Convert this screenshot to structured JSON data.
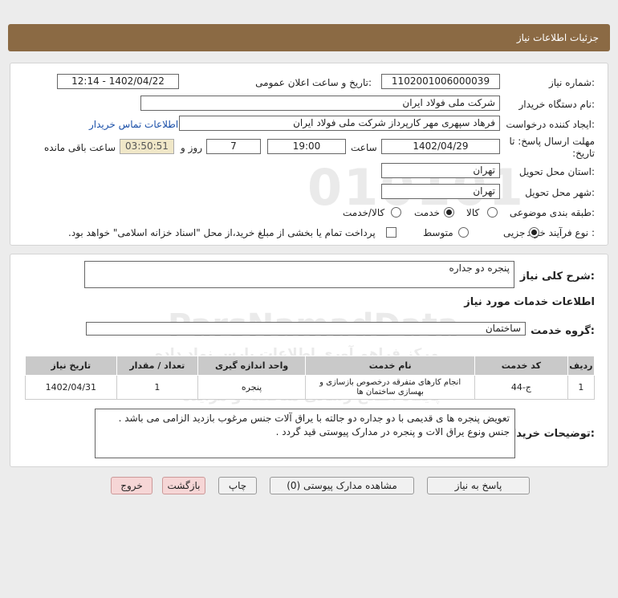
{
  "header": {
    "title": "جزئیات اطلاعات نیاز"
  },
  "form": {
    "need_number_label": "شماره نیاز:",
    "need_number": "1102001006000039",
    "announce_label": "تاریخ و ساعت اعلان عمومی:",
    "announce_value": "1402/04/22 - 12:14",
    "buyer_org_label": "نام دستگاه خریدار:",
    "buyer_org": "شرکت ملی فولاد ایران",
    "creator_label": "ایجاد کننده درخواست:",
    "creator": "فرهاد سپهری مهر کارپرداز شرکت ملی فولاد ایران",
    "contact_link": "اطلاعات تماس خریدار",
    "deadline_label": "مهلت ارسال پاسخ: تا تاریخ:",
    "deadline_date": "1402/04/29",
    "time_label": "ساعت",
    "deadline_time": "19:00",
    "days_value": "7",
    "days_label": "روز و",
    "remaining_time": "03:50:51",
    "remaining_label": "ساعت باقی مانده",
    "province_label": "استان محل تحویل:",
    "province": "تهران",
    "city_label": "شهر محل تحویل:",
    "city": "تهران",
    "category_label": "طبقه بندی موضوعی:",
    "category_options": [
      "کالا",
      "خدمت",
      "کالا/خدمت"
    ],
    "category_selected": "خدمت",
    "process_label": "نوع فرآیند خرید :",
    "process_options": [
      "جزیی",
      "متوسط"
    ],
    "process_selected": "جزیی",
    "payment_note": "پرداخت تمام یا بخشی از مبلغ خرید،از محل \"اسناد خزانه اسلامی\" خواهد بود."
  },
  "details": {
    "summary_label": "شرح کلی نیاز:",
    "summary": "پنجره دو جداره",
    "services_heading": "اطلاعات خدمات مورد نیاز",
    "service_group_label": "گروه خدمت:",
    "service_group": "ساختمان",
    "table": {
      "headers": [
        "ردیف",
        "کد خدمت",
        "نام خدمت",
        "واحد اندازه گیری",
        "تعداد / مقدار",
        "تاریخ نیاز"
      ],
      "rows": [
        [
          "1",
          "ج-44",
          "انجام کارهای متفرقه درخصوص بازسازی و بهسازی ساختمان ها",
          "پنجره",
          "1",
          "1402/04/31"
        ]
      ]
    },
    "buyer_notes_label": "توضیحات خریدار:",
    "buyer_notes": "تعویض پنجره ها ی قدیمی با دو جداره دو جالته با یراق آلات جنس مرغوب بازدید الزامی می باشد . جنس ونوع یراق الات و پنجره در مدارک پیوستی قید گردد ."
  },
  "buttons": {
    "respond": "پاسخ به نیاز",
    "view_attachments": "مشاهده مدارک پیوستی (0)",
    "print": "چاپ",
    "back": "بازگشت",
    "exit": "خروج"
  },
  "watermark": {
    "brand": "ParsNamadData",
    "line1": "مرکز فراهم آوری اطلاعات پارس نماد داده",
    "line2": "پایگاه اطلاع رسانی مناقصه و مزایده",
    "phone": "۰۲۱-۸۸۳۴۹۶۷۰",
    "digits": "010101"
  }
}
